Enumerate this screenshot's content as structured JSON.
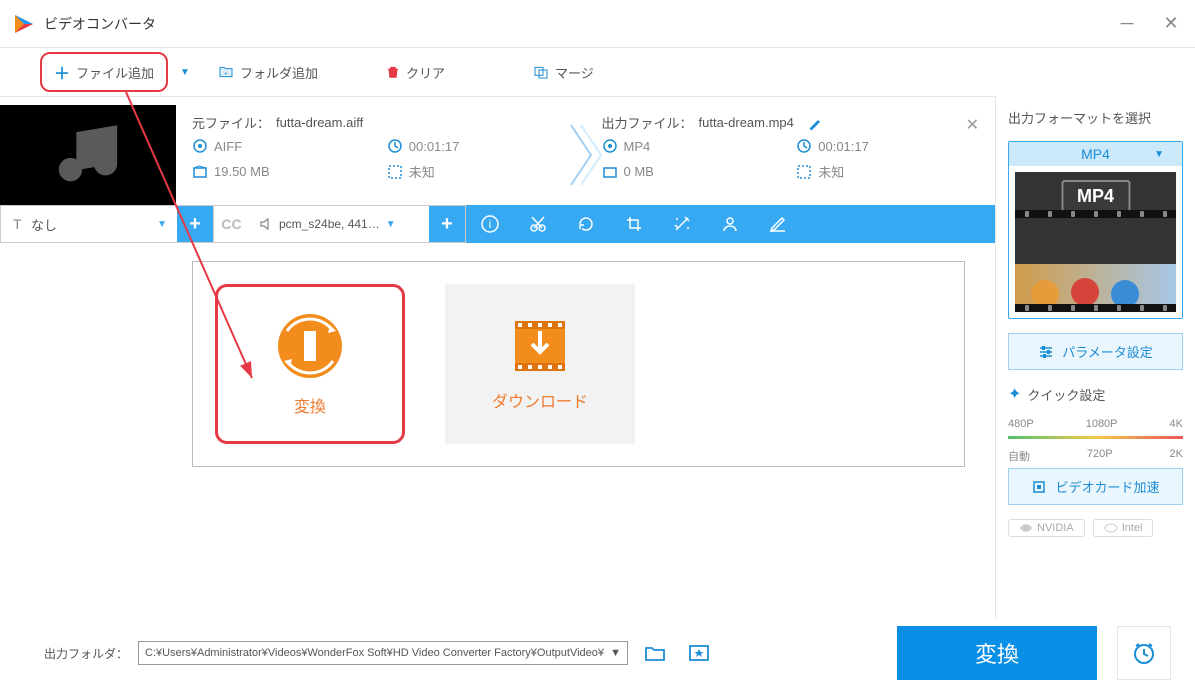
{
  "window": {
    "title": "ビデオコンバータ"
  },
  "toolbar": {
    "add_file": "ファイル追加",
    "add_folder": "フォルダ追加",
    "clear": "クリア",
    "merge": "マージ"
  },
  "file": {
    "source_label": "元ファイル：",
    "source_name": "futta-dream.aiff",
    "output_label": "出力ファイル：",
    "output_name": "futta-dream.mp4",
    "src_format": "AIFF",
    "src_duration": "00:01:17",
    "src_size": "19.50 MB",
    "src_resolution": "未知",
    "out_format": "MP4",
    "out_duration": "00:01:17",
    "out_size": "0 MB",
    "out_resolution": "未知"
  },
  "actionbar": {
    "text_track": "なし",
    "audio_codec": "pcm_s24be, 441…"
  },
  "cards": {
    "convert": "変換",
    "download": "ダウンロード"
  },
  "sidebar": {
    "format_label": "出力フォーマットを選択",
    "format": "MP4",
    "mp4_badge": "MP4",
    "param_btn": "パラメータ設定",
    "quick_label": "クイック設定",
    "q": {
      "p480": "480P",
      "p1080": "1080P",
      "p4k": "4K",
      "auto": "自動",
      "p720": "720P",
      "p2k": "2K"
    },
    "gpu_btn": "ビデオカード加速",
    "nvidia": "NVIDIA",
    "intel": "Intel"
  },
  "footer": {
    "out_label": "出力フォルダ：",
    "out_path": "C:¥Users¥Administrator¥Videos¥WonderFox Soft¥HD Video Converter Factory¥OutputVideo¥",
    "convert": "変換"
  }
}
